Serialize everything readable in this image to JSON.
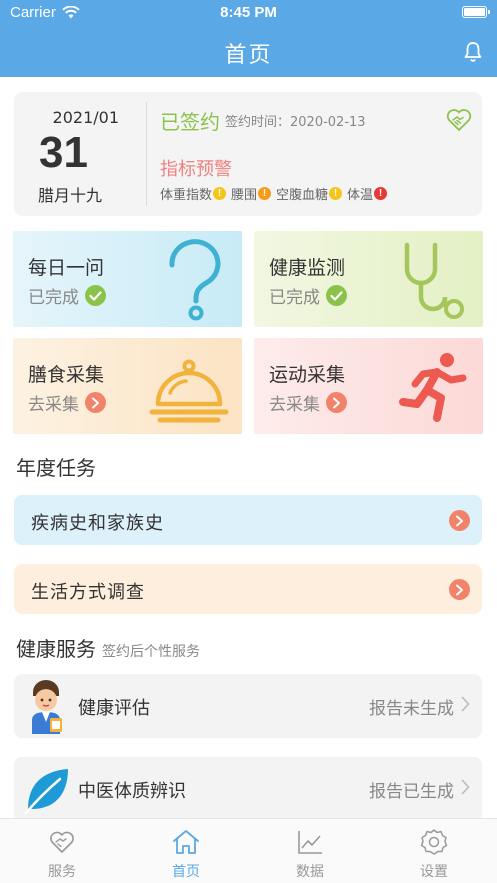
{
  "status_bar": {
    "carrier": "Carrier",
    "time": "8:45 PM"
  },
  "nav": {
    "title": "首页",
    "right_icon": "bell-icon"
  },
  "sign_card": {
    "year_month": "2021/01",
    "day": "31",
    "lunar": "腊月十九",
    "signed_label": "已签约",
    "sign_time": "签约时间：2020-02-13",
    "alert_title": "指标预警",
    "indicators": [
      {
        "label": "体重指数",
        "level": "yellow"
      },
      {
        "label": "腰围",
        "level": "orange"
      },
      {
        "label": "空腹血糖",
        "level": "yellow"
      },
      {
        "label": "体温",
        "level": "red"
      }
    ]
  },
  "tiles": [
    {
      "title": "每日一问",
      "status": "已完成",
      "icon": "question-mark-icon"
    },
    {
      "title": "健康监测",
      "status": "已完成",
      "icon": "stethoscope-icon"
    },
    {
      "title": "膳食采集",
      "status": "去采集",
      "icon": "food-cloche-icon"
    },
    {
      "title": "运动采集",
      "status": "去采集",
      "icon": "running-person-icon"
    }
  ],
  "annual_tasks": {
    "title": "年度任务",
    "items": [
      {
        "label": "疾病史和家族史"
      },
      {
        "label": "生活方式调查"
      }
    ]
  },
  "health_services": {
    "title": "健康服务",
    "subtitle": "签约后个性服务",
    "items": [
      {
        "label": "健康评估",
        "status": "报告未生成",
        "icon": "doctor-avatar-icon"
      },
      {
        "label": "中医体质辨识",
        "status": "报告已生成",
        "icon": "leaf-icon"
      }
    ]
  },
  "tabbar": {
    "items": [
      {
        "label": "服务",
        "icon": "heart-hand-icon",
        "active": false
      },
      {
        "label": "首页",
        "icon": "home-icon",
        "active": true
      },
      {
        "label": "数据",
        "icon": "chart-icon",
        "active": false
      },
      {
        "label": "设置",
        "icon": "gear-icon",
        "active": false
      }
    ]
  },
  "colors": {
    "header": "#5aa9e6",
    "signed": "#8bc34a",
    "alert": "#f08080",
    "arrow": "#f2836b",
    "active_tab": "#5aa9e6"
  }
}
